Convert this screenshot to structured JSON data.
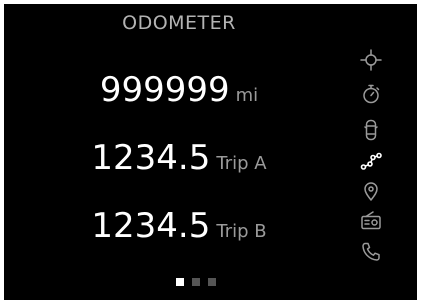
{
  "screen": {
    "title": "ODOMETER"
  },
  "readings": {
    "odometer": {
      "value": "999999",
      "unit": "mi"
    },
    "trip_a": {
      "value": "1234.5",
      "label": "Trip A"
    },
    "trip_b": {
      "value": "1234.5",
      "label": "Trip B"
    }
  },
  "sidebar": {
    "icons": [
      "crosshair-icon",
      "timer-icon",
      "car-top-view-icon",
      "route-icon",
      "location-pin-icon",
      "radio-icon",
      "phone-icon"
    ],
    "active_icon": "route-icon"
  },
  "pagination": {
    "total_pages": 3,
    "current_page": 1
  },
  "colors": {
    "background": "#000000",
    "primary_text": "#ffffff",
    "secondary_text": "#9a9a9a",
    "icon": "#9a9a9a",
    "active_icon": "#ffffff"
  }
}
